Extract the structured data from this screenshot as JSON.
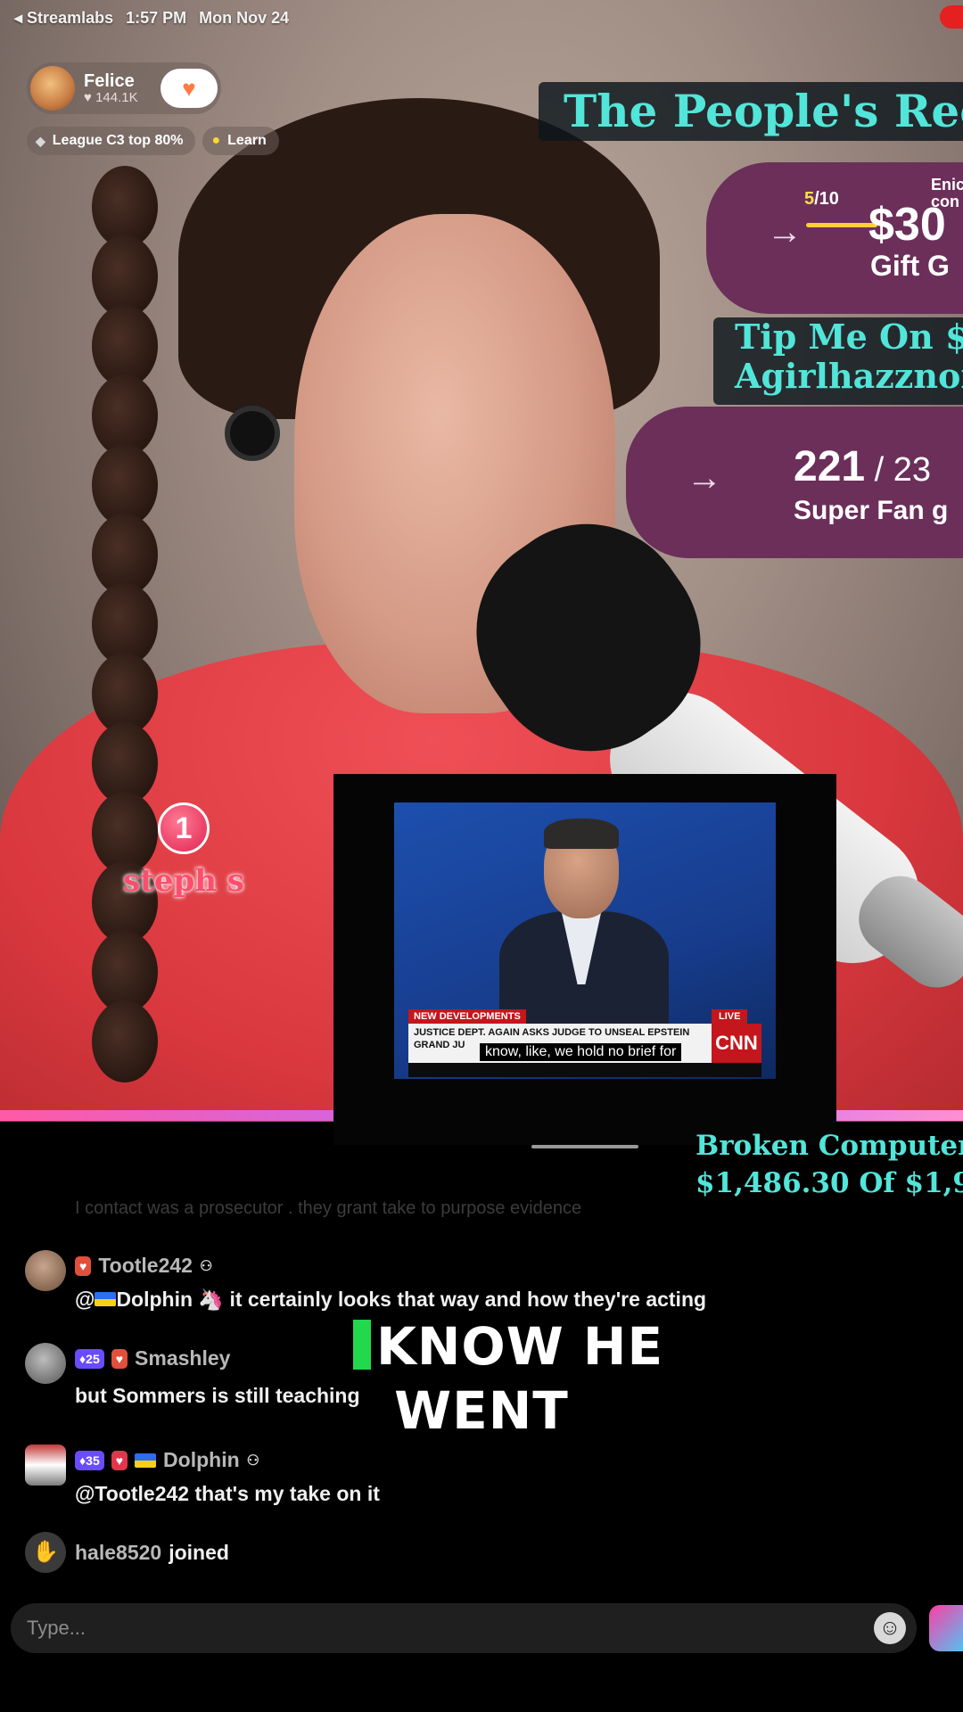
{
  "status": {
    "app": "Streamlabs",
    "time": "1:57 PM",
    "date": "Mon Nov 24"
  },
  "host": {
    "name": "Felice",
    "likes": "144.1K"
  },
  "tags": {
    "league": "League C3 top 80%",
    "learn": "Learn"
  },
  "overlay": {
    "banner": "The People's Rec",
    "goal1": {
      "count_current": "5",
      "count_total": "/10",
      "amount": "$30",
      "label": "Gift G",
      "side": "Enic\ncon"
    },
    "tip": {
      "line1": "Tip Me On $",
      "line2": "Agirlhazznon"
    },
    "goal2": {
      "current": "221",
      "rest": " / 23",
      "label": "Super Fan g"
    },
    "gifter": {
      "rank": "1",
      "name": "steph s"
    },
    "broken": {
      "line1": "Broken Computer",
      "line2": "$1,486.30 Of $1,90"
    }
  },
  "tv": {
    "tag": "NEW DEVELOPMENTS",
    "live": "LIVE",
    "chyron": "JUSTICE DEPT. AGAIN ASKS JUDGE TO UNSEAL EPSTEIN GRAND JU",
    "network": "CNN",
    "caption": "know, like, we hold no brief for"
  },
  "chat": {
    "faded": "I contact was a prosecutor . they grant take to purpose evidence",
    "messages": [
      {
        "user": "Tootle242",
        "badge1": "",
        "mention": "@",
        "flag_name": "Dolphin",
        "text": "it certainly looks that way and how they're acting"
      },
      {
        "user": "Smashley",
        "level": "25",
        "text": "but Sommers is still teaching"
      },
      {
        "user": "Dolphin",
        "level": "35",
        "text": "@Tootle242 that's my take on it"
      }
    ],
    "join": {
      "user": "hale8520",
      "action": "joined"
    }
  },
  "subtitle": {
    "line1": "KNOW HE",
    "line2": "WENT"
  },
  "input": {
    "placeholder": "Type..."
  }
}
